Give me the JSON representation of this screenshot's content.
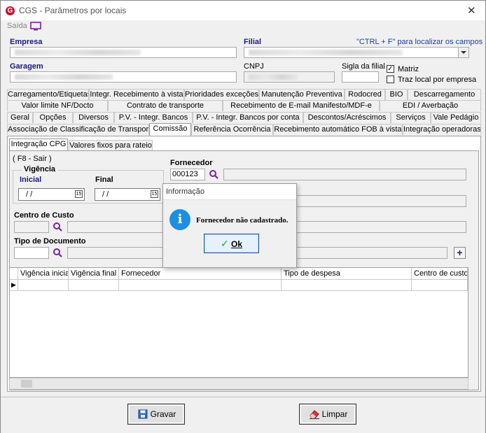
{
  "window": {
    "title": "CGS - Parâmetros por locais",
    "logo_letter": "G",
    "close_glyph": "✕"
  },
  "menu": {
    "saida": "Saída"
  },
  "header": {
    "empresa_label": "Empresa",
    "filial_label": "Filial",
    "hint": "\"CTRL + F\" para localizar os campos",
    "garagem_label": "Garagem",
    "cnpj_label": "CNPJ",
    "sigla_label": "Sigla da filial",
    "matriz_label": "Matriz",
    "matriz_checked": "✓",
    "traz_local_label": "Traz local por empresa"
  },
  "tabs": {
    "row1": [
      "Carregamento/Etiquetas",
      "Integr. Recebimento à vista",
      "Prioridades exceções",
      "Manutenção Preventiva",
      "Rodocred",
      "BIO",
      "Descarregamento"
    ],
    "row2": [
      "Valor limite NF/Docto",
      "Contrato de transporte",
      "Recebimento de E-mail Manifesto/MDF-e",
      "EDI / Averbação"
    ],
    "row3": [
      "Geral",
      "Opções",
      "Diversos",
      "P.V. - Integr. Bancos",
      "P.V. - Integr. Bancos por conta",
      "Descontos/Acréscimos",
      "Serviços",
      "Vale Pedágio"
    ],
    "row4": [
      "Associação de Classificação de Transporte",
      "Comissão",
      "Referência Ocorrência",
      "Recebimento automático FOB à vista",
      "Integração operadoras"
    ]
  },
  "subtabs": [
    "Integração CPG",
    "Valores fixos para rateio"
  ],
  "form": {
    "hint": "( F8 - Sair )",
    "vigencia_label": "Vigência",
    "inicial_label": "Inicial",
    "final_label": "Final",
    "inicial_value": "/ /",
    "final_value": "/ /",
    "cal_glyph": "15",
    "fornecedor_label": "Fornecedor",
    "fornecedor_value": "000123",
    "centro_custo_label": "Centro de Custo",
    "tipo_documento_label": "Tipo de Documento",
    "add_glyph": "+"
  },
  "grid": {
    "columns": [
      "Vigência inicial",
      "Vigência final",
      "Fornecedor",
      "Tipo de despesa",
      "Centro de custo"
    ],
    "row_indicator": "▶"
  },
  "dialog": {
    "title": "Informação",
    "message": "Fornecedor não cadastrado.",
    "info_glyph": "i",
    "ok_label": "Ok",
    "ok_check": "✓"
  },
  "buttons": {
    "gravar": "Gravar",
    "limpar": "Limpar"
  },
  "colors": {
    "accent_purple": "#7b1fa2",
    "label_blue": "#1a1a80",
    "info_blue": "#1e8fe0",
    "ok_green": "#2e9b2e"
  }
}
